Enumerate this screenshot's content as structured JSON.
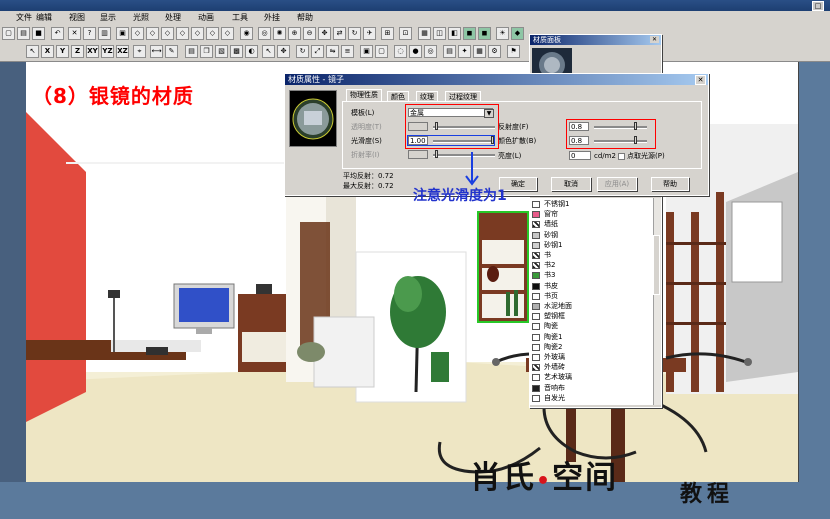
{
  "menu": [
    "文件",
    "编辑",
    "视图",
    "显示",
    "光照",
    "处理",
    "动画",
    "工具",
    "外挂",
    "帮助"
  ],
  "toolbar2_labels": [
    "X",
    "Y",
    "Z",
    "XY",
    "YZ",
    "XZ"
  ],
  "caption": "（8）银镜的材质",
  "note": "注意光滑度为1",
  "material_dialog": {
    "title": "材质属性 - 镜子",
    "tabs": [
      "物理性质",
      "颜色",
      "纹理",
      "过程纹理"
    ],
    "template_label": "模板(L)",
    "template_value": "金属",
    "transparency_label": "透明度(T)",
    "smoothness_label": "光滑度(S)",
    "smoothness_value": "1.00",
    "refraction_label": "折射率(I)",
    "reflectance_label": "反射度(F)",
    "reflectance_value": "0.8",
    "color_diffuse_label": "颜色扩散(B)",
    "color_diffuse_value": "0.8",
    "brightness_label": "亮度(L)",
    "brightness_value": "0",
    "brightness_unit": "cd/m2",
    "point_light_label": "点取光源(P)",
    "avg_reflect": "平均反射：0.72",
    "max_reflect": "最大反射：0.72",
    "buttons": {
      "ok": "确定",
      "cancel": "取消",
      "apply": "应用(A)",
      "help": "帮助"
    }
  },
  "material_panel": {
    "title": "材质面板",
    "items": [
      {
        "label": "不锈钢1",
        "color": "#ffffff",
        "icon": "none"
      },
      {
        "label": "窗帘",
        "color": "#e85a8a",
        "icon": "none"
      },
      {
        "label": "墙纸",
        "color": "#ffffff",
        "icon": "texture-icon"
      },
      {
        "label": "砂钢",
        "color": "#c8c8c8",
        "icon": "none"
      },
      {
        "label": "砂钢1",
        "color": "#d0d0d0",
        "icon": "none"
      },
      {
        "label": "书",
        "color": "#ffffff",
        "icon": "texture-icon"
      },
      {
        "label": "书2",
        "color": "#ffffff",
        "icon": "texture-icon"
      },
      {
        "label": "书3",
        "color": "#3a9a3a",
        "icon": "none"
      },
      {
        "label": "书皮",
        "color": "#101010",
        "icon": "none"
      },
      {
        "label": "书页",
        "color": "#ffffff",
        "icon": "none"
      },
      {
        "label": "水泥地面",
        "color": "#b0b0b0",
        "icon": "none"
      },
      {
        "label": "塑钢框",
        "color": "#ffffff",
        "icon": "none"
      },
      {
        "label": "陶瓷",
        "color": "#ffffff",
        "icon": "none"
      },
      {
        "label": "陶瓷1",
        "color": "#ffffff",
        "icon": "none"
      },
      {
        "label": "陶瓷2",
        "color": "#ffffff",
        "icon": "none"
      },
      {
        "label": "外玻璃",
        "color": "#ffffff",
        "icon": "none"
      },
      {
        "label": "外墙砖",
        "color": "#ffffff",
        "icon": "texture-icon"
      },
      {
        "label": "艺术玻璃",
        "color": "#ffffff",
        "icon": "none"
      },
      {
        "label": "音响布",
        "color": "#202020",
        "icon": "none"
      },
      {
        "label": "自发光",
        "color": "#ffffff",
        "icon": "none"
      }
    ]
  },
  "logo": {
    "main_a": "肖氏",
    "dot": "•",
    "main_b": "空间",
    "sub": "教程"
  },
  "colors": {
    "caption": "#ff0000",
    "note": "#2233cc",
    "highlight_red": "#ff0000",
    "highlight_blue": "#1a3fe0"
  }
}
